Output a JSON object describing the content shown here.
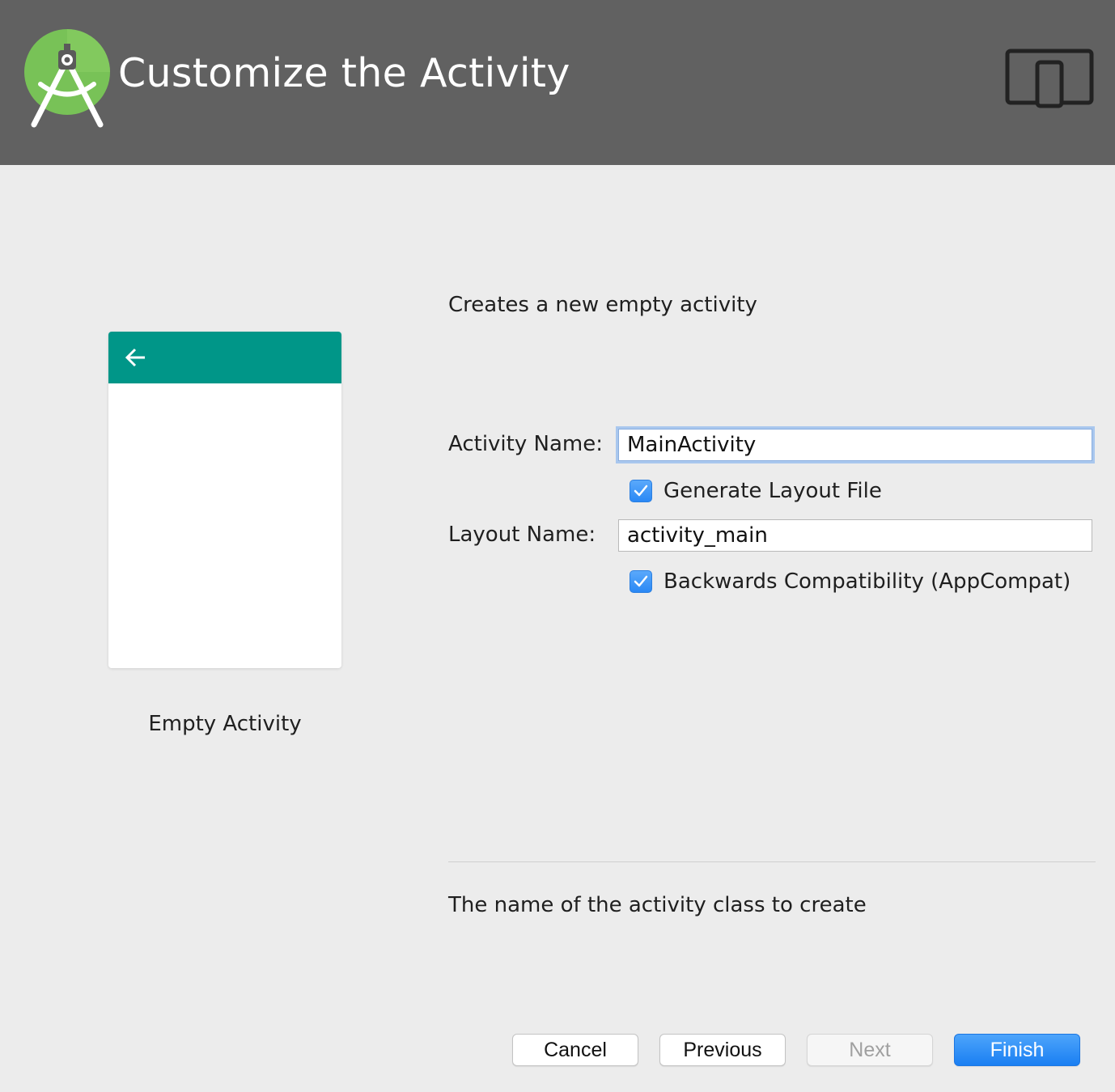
{
  "header": {
    "title": "Customize the Activity",
    "logo_icon": "android-studio-logo",
    "device_icon": "tablet-phone-icon",
    "background": "#616161"
  },
  "preview": {
    "template_name": "Empty Activity",
    "appbar_color": "#009688",
    "back_icon": "back-arrow-icon"
  },
  "form": {
    "description": "Creates a new empty activity",
    "activity_name_label": "Activity Name:",
    "activity_name_value": "MainActivity",
    "generate_layout_label": "Generate Layout File",
    "generate_layout_checked": true,
    "layout_name_label": "Layout Name:",
    "layout_name_value": "activity_main",
    "backwards_compat_label": "Backwards Compatibility (AppCompat)",
    "backwards_compat_checked": true,
    "help_text": "The name of the activity class to create"
  },
  "buttons": {
    "cancel": "Cancel",
    "previous": "Previous",
    "next": "Next",
    "finish": "Finish"
  },
  "colors": {
    "accent": "#2a88f5",
    "window_bg": "#ececec"
  }
}
